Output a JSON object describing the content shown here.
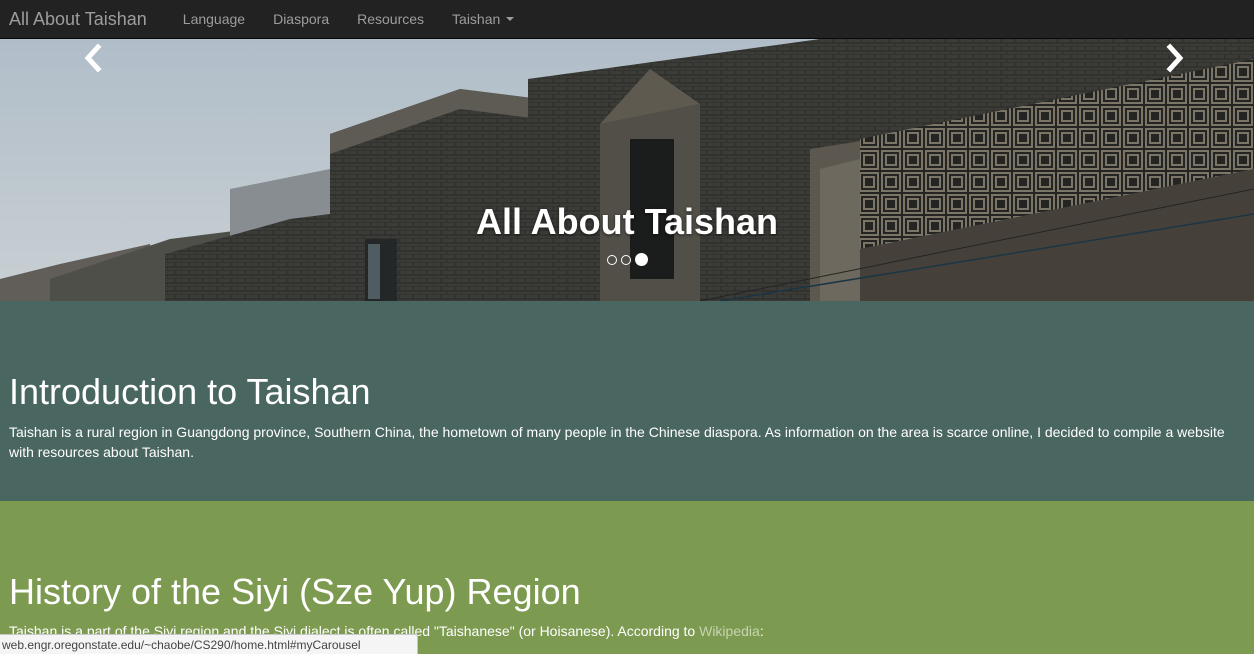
{
  "navbar": {
    "brand": "All About Taishan",
    "links": [
      "Language",
      "Diaspora",
      "Resources",
      "Taishan"
    ]
  },
  "carousel": {
    "caption": "All About Taishan",
    "slide_count": 3,
    "active_slide": 3
  },
  "intro": {
    "title": "Introduction to Taishan",
    "body": "Taishan is a rural region in Guangdong province, Southern China, the hometown of many people in the Chinese diaspora. As information on the area is scarce online, I decided to compile a website with resources about Taishan."
  },
  "history": {
    "title": "History of the Siyi (Sze Yup) Region",
    "body_prefix": "Taishan is a part of the Siyi region and the Siyi dialect is often called \"Taishanese\" (or Hoisanese). According to ",
    "link_text": "Wikipedia",
    "body_suffix": ":"
  },
  "status_bar": {
    "url": "web.engr.oregonstate.edu/~chaobe/CS290/home.html#myCarousel"
  },
  "colors": {
    "navbar_bg": "#222222",
    "intro_bg": "#4a6661",
    "history_bg": "#7d9a51"
  },
  "icons": [
    "chevron-left-icon",
    "chevron-right-icon",
    "caret-down-icon"
  ]
}
